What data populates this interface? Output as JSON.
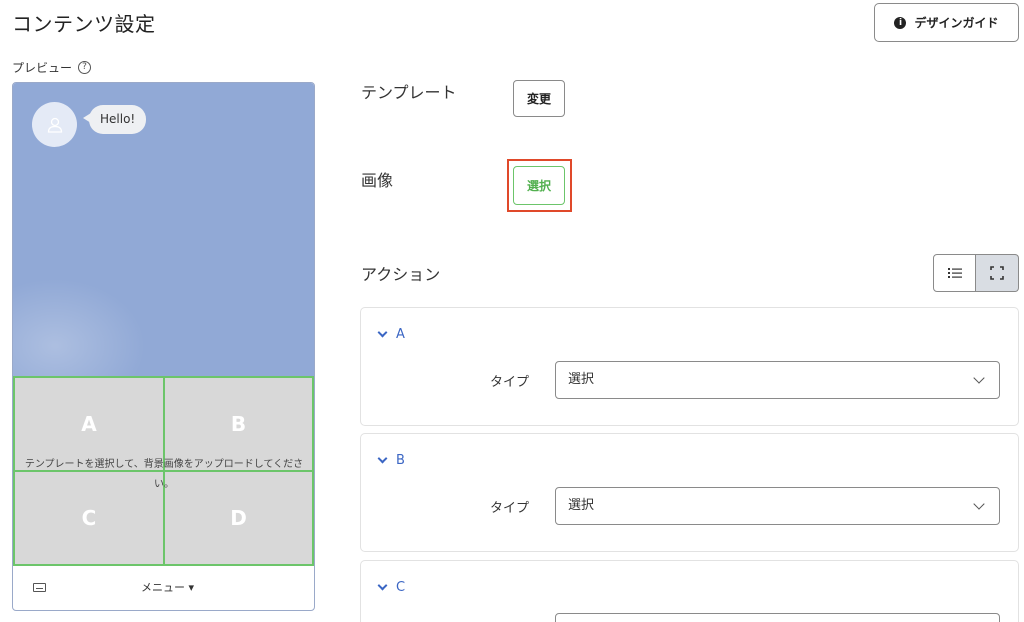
{
  "header": {
    "title": "コンテンツ設定",
    "design_guide_label": "デザインガイド"
  },
  "preview": {
    "label": "プレビュー",
    "bubble_text": "Hello!",
    "cells": [
      "A",
      "B",
      "C",
      "D"
    ],
    "hint": "テンプレートを選択して、背景画像をアップロードしてください。",
    "menu_label": "メニュー ▾"
  },
  "settings": {
    "template_label": "テンプレート",
    "template_button": "変更",
    "image_label": "画像",
    "image_button": "選択",
    "action_label": "アクション"
  },
  "actions": [
    {
      "name": "A",
      "type_label": "タイプ",
      "type_value": "選択"
    },
    {
      "name": "B",
      "type_label": "タイプ",
      "type_value": "選択"
    },
    {
      "name": "C",
      "type_label": "タイプ",
      "type_value": ""
    }
  ],
  "colors": {
    "chat_bg": "#91a9d6",
    "grid_border": "#6cc56a",
    "highlight": "#e0492a",
    "link_blue": "#3b66c4"
  }
}
